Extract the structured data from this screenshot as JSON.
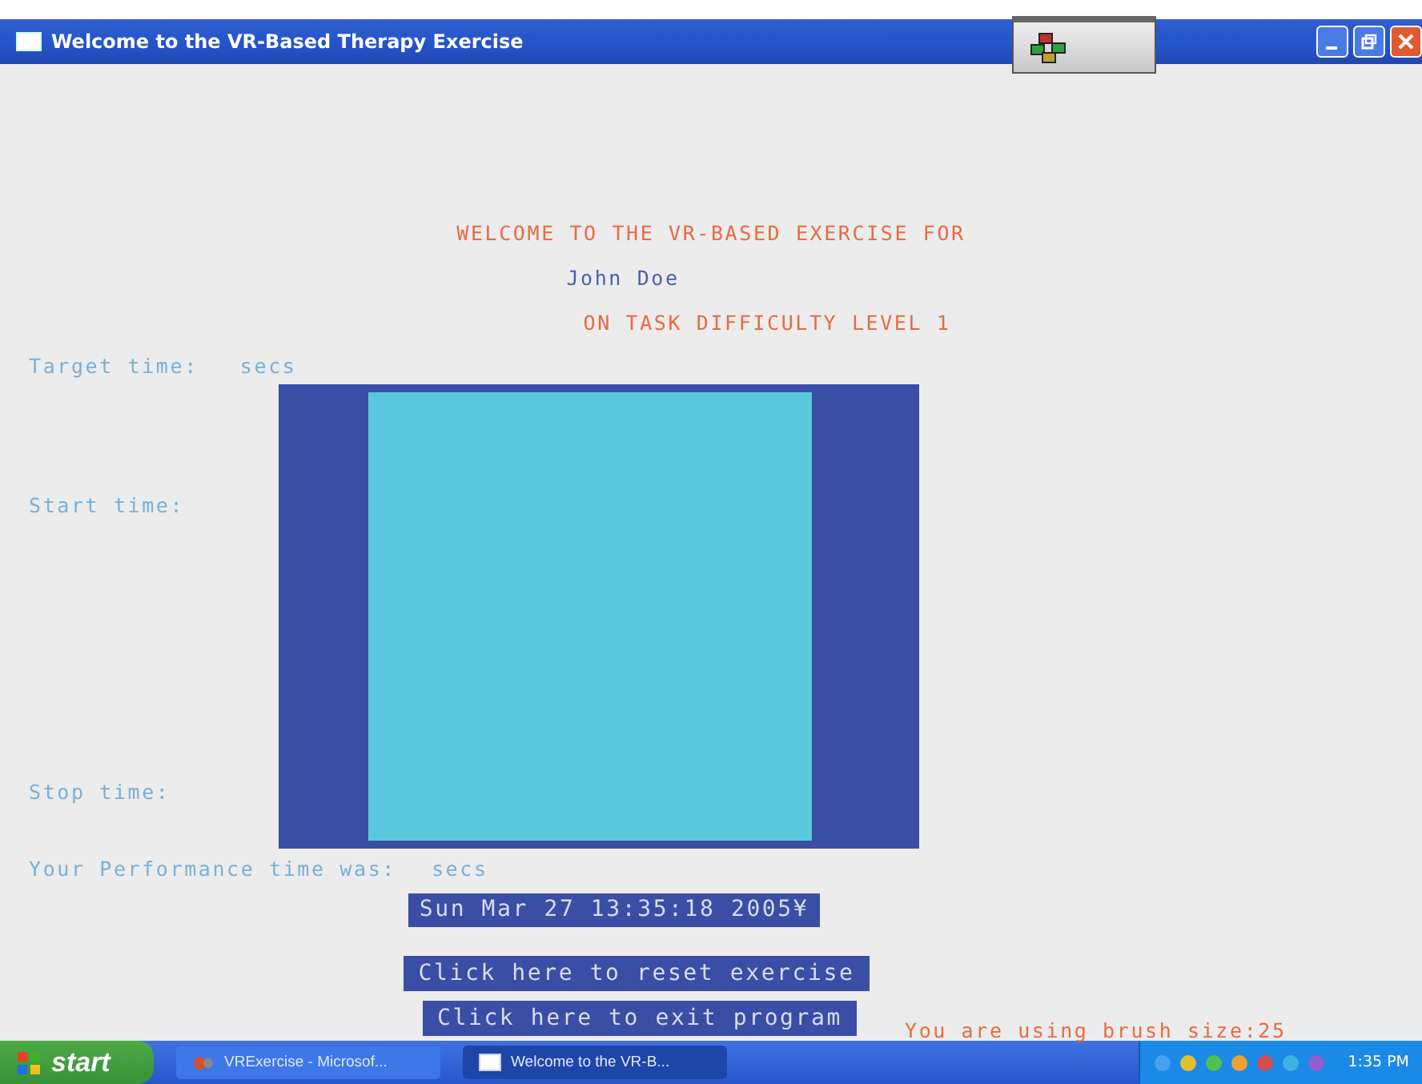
{
  "window": {
    "title": "Welcome to the VR-Based Therapy Exercise"
  },
  "heading": [
    "WELCOME TO THE VR-BASED EXERCISE FOR",
    "John Doe",
    "ON TASK DIFFICULTY LEVEL 1"
  ],
  "target_time": {
    "label": "Target time:",
    "value": "secs"
  },
  "start_time": {
    "label": "Start time:"
  },
  "stop_time": {
    "label": "Stop time:"
  },
  "performance": {
    "label": "Your Performance time was:",
    "value": "secs"
  },
  "date": "Sun Mar 27 13:35:18 2005¥",
  "buttons": [
    "Click here to reset exercise",
    "Click here to exit program"
  ],
  "brush_status": "You are using brush size:25",
  "taskbar": {
    "start": "start",
    "tasks": [
      {
        "label": "VRExercise - Microsof...",
        "kind": "app",
        "selected": false
      },
      {
        "label": "Welcome to the VR-B...",
        "kind": "window",
        "selected": true
      }
    ],
    "clock": "1:35 PM"
  }
}
